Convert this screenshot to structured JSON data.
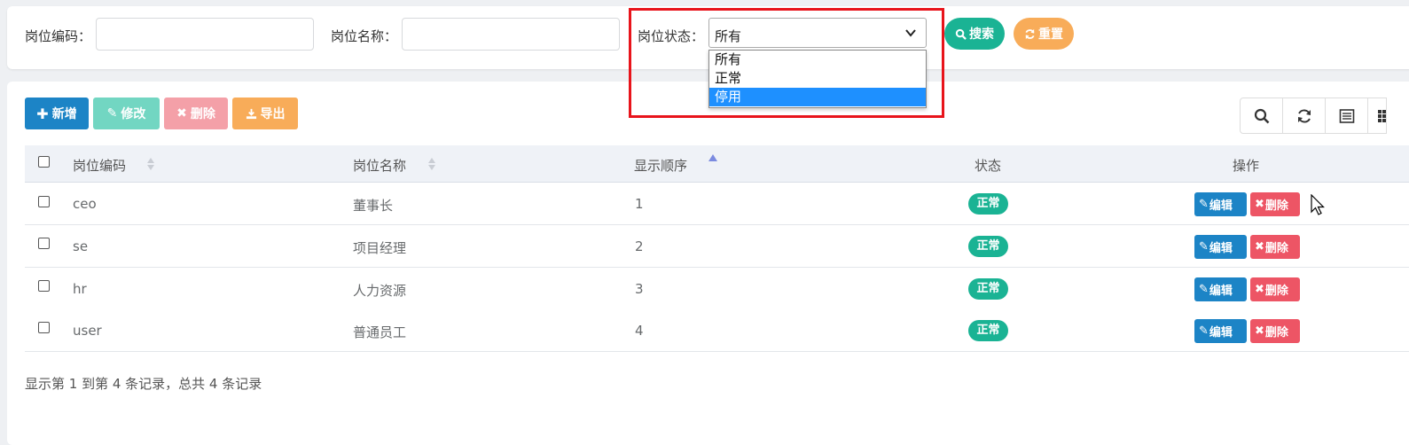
{
  "search": {
    "post_code_label": "岗位编码：",
    "post_name_label": "岗位名称：",
    "status_label": "岗位状态：",
    "status_selected": "所有",
    "status_options": [
      "所有",
      "正常",
      "停用"
    ],
    "search_button": "搜索",
    "reset_button": "重置"
  },
  "toolbar": {
    "add_label": "新增",
    "edit_label": "修改",
    "delete_label": "删除",
    "export_label": "导出",
    "icons": [
      "search-icon",
      "refresh-icon",
      "columns-icon",
      "grid-icon"
    ]
  },
  "table": {
    "headers": [
      "岗位编码",
      "岗位名称",
      "显示顺序",
      "状态",
      "操作"
    ],
    "rows": [
      {
        "code": "ceo",
        "name": "董事长",
        "order": "1",
        "status": "正常"
      },
      {
        "code": "se",
        "name": "项目经理",
        "order": "2",
        "status": "正常"
      },
      {
        "code": "hr",
        "name": "人力资源",
        "order": "3",
        "status": "正常"
      },
      {
        "code": "user",
        "name": "普通员工",
        "order": "4",
        "status": "正常"
      }
    ],
    "row_edit_label": "编辑",
    "row_delete_label": "删除"
  },
  "pager": {
    "summary": "显示第 1 到第 4 条记录，总共 4 条记录"
  },
  "colors": {
    "primary": "#1c84c6",
    "success": "#1ab394",
    "warning": "#f8ac59",
    "danger": "#ed5565",
    "highlight": "#e8141b"
  }
}
